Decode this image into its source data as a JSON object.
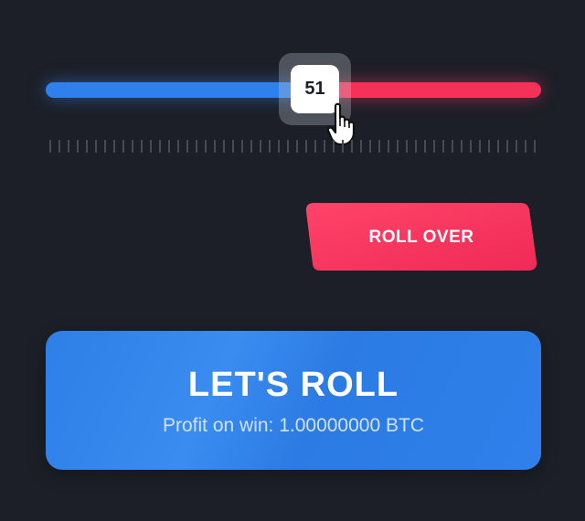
{
  "slider": {
    "value": "51",
    "fraction": 0.51,
    "low_color": "#2f80ea",
    "high_color": "#f5315a",
    "handle_icon": "hand-pointer-icon"
  },
  "roll_over_button": {
    "label": "ROLL OVER",
    "color": "#f5315a"
  },
  "lets_roll_button": {
    "title": "LET'S ROLL",
    "subtitle": "Profit on win: 1.00000000 BTC",
    "color": "#2f80ea"
  }
}
